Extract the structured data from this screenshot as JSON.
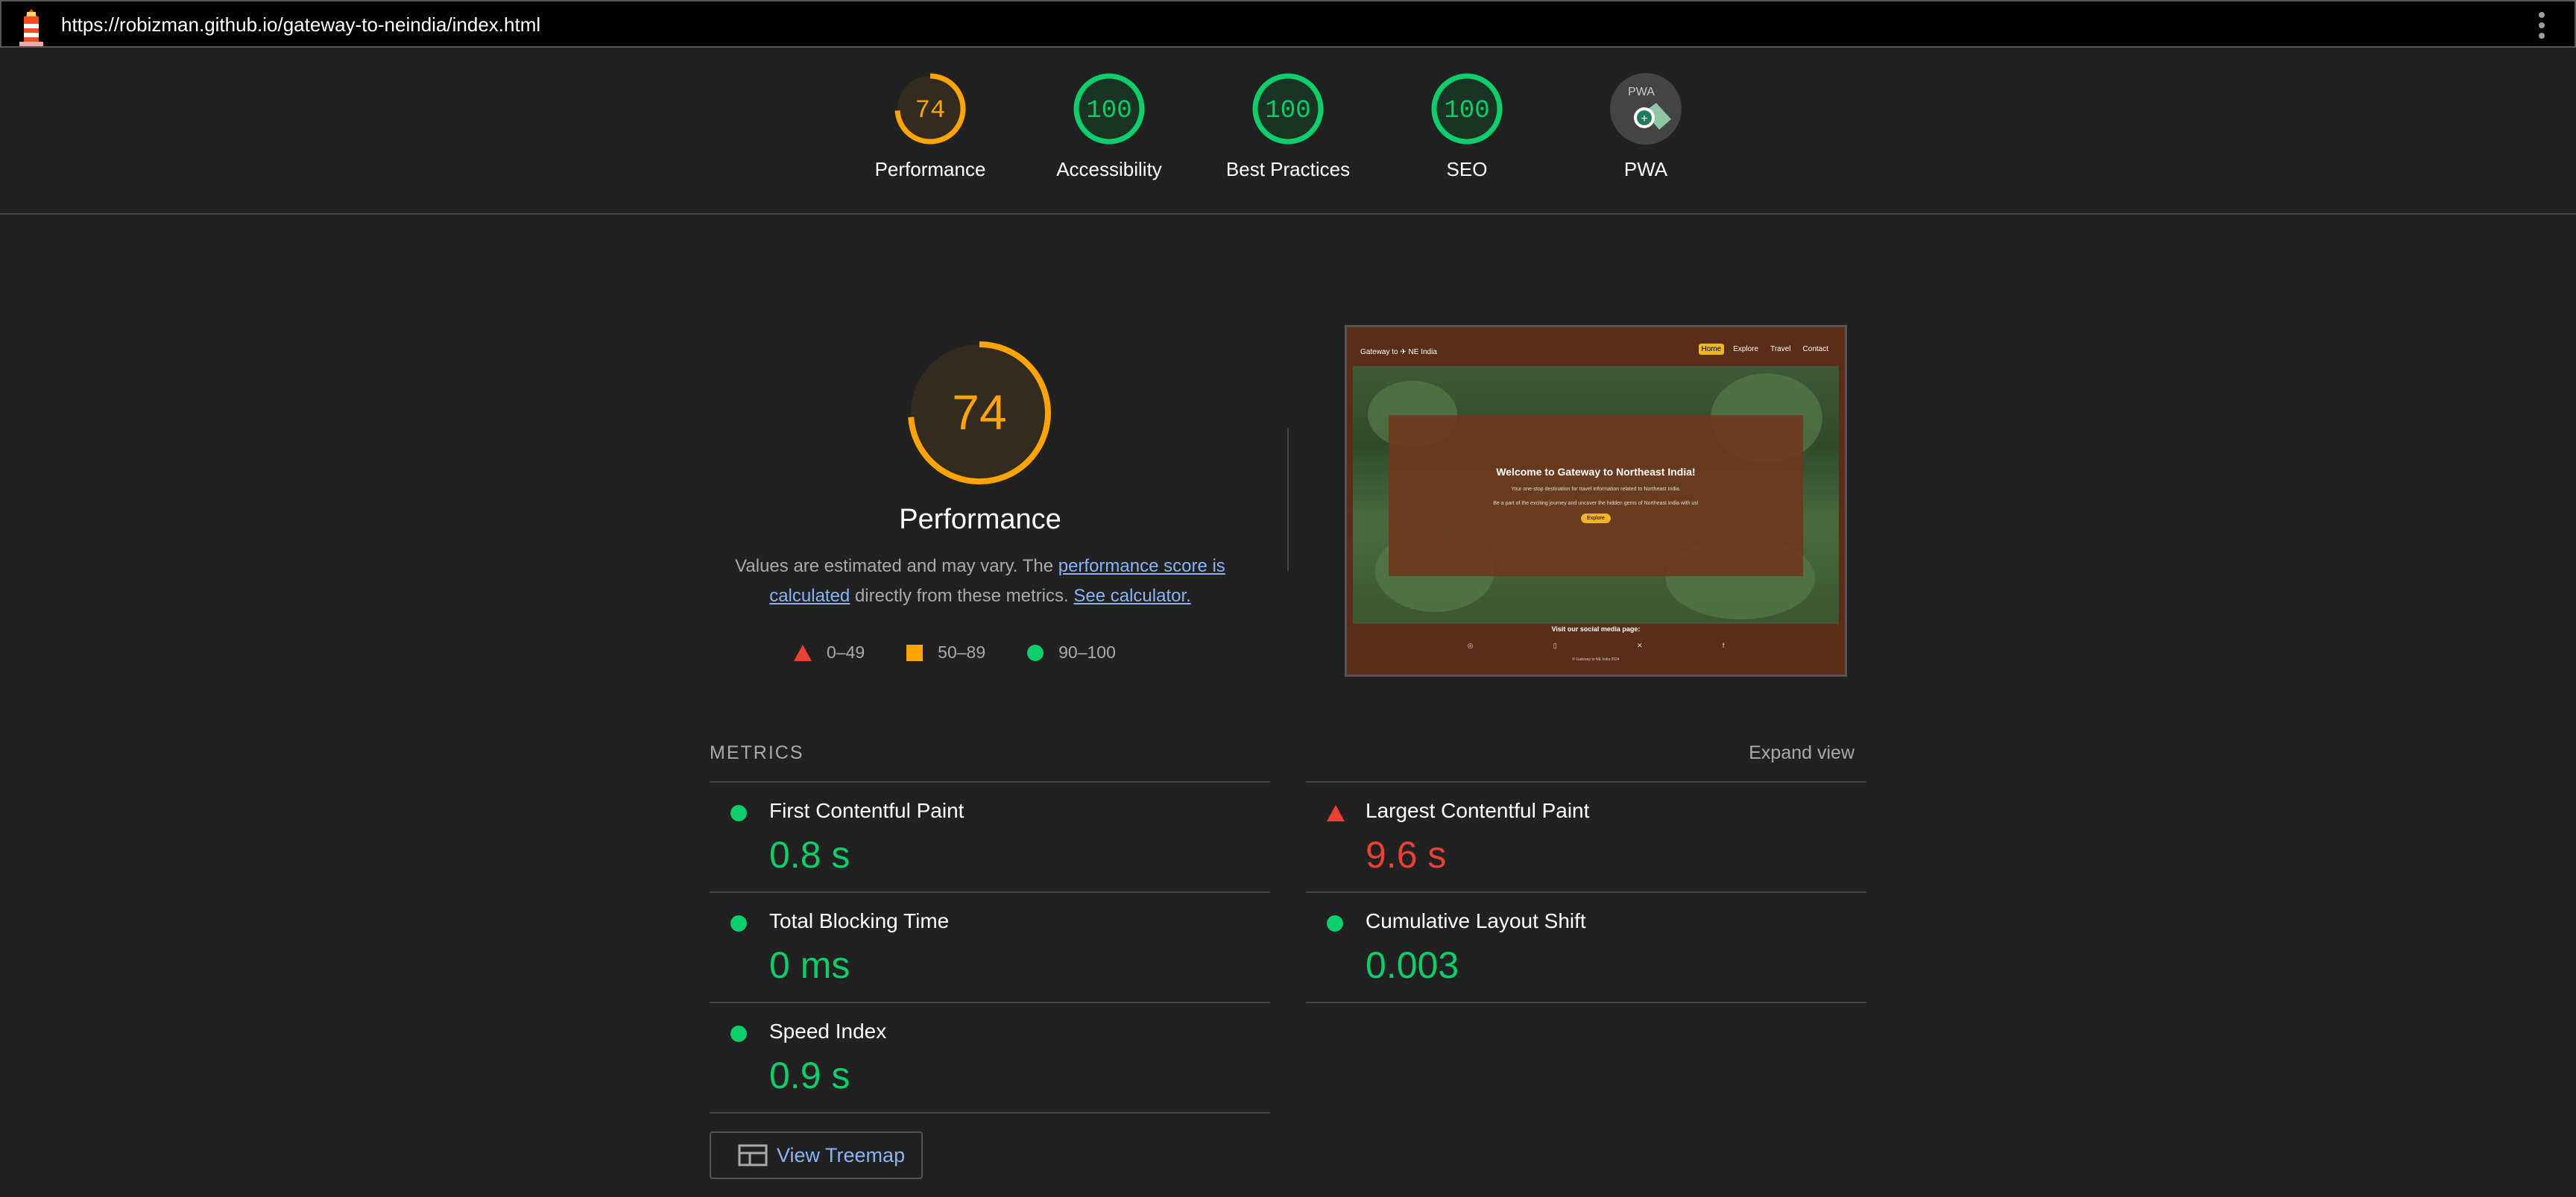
{
  "url": "https://robizman.github.io/gateway-to-neindia/index.html",
  "categories": [
    {
      "label": "Performance",
      "score": "74",
      "pct": 74,
      "color": "#ffa400"
    },
    {
      "label": "Accessibility",
      "score": "100",
      "pct": 100,
      "color": "#0cce6b"
    },
    {
      "label": "Best Practices",
      "score": "100",
      "pct": 100,
      "color": "#0cce6b"
    },
    {
      "label": "SEO",
      "score": "100",
      "pct": 100,
      "color": "#0cce6b"
    },
    {
      "label": "PWA",
      "score": "",
      "pct": 0,
      "color": "#9aa0a6",
      "badge": "PWA"
    }
  ],
  "performance": {
    "score": "74",
    "pct": 74,
    "title": "Performance",
    "desc_prefix": "Values are estimated and may vary. The ",
    "desc_link1": "performance score is calculated",
    "desc_middle": " directly from these metrics. ",
    "desc_link2": "See calculator.",
    "legend": [
      "0–49",
      "50–89",
      "90–100"
    ]
  },
  "screenshot": {
    "brand": "Gateway to",
    "brand_suffix": "NE India",
    "nav": [
      "Home",
      "Explore",
      "Travel",
      "Contact"
    ],
    "hero_title": "Welcome to Gateway to Northeast India!",
    "hero_text1": "Your one-stop destination for travel information related to Northeast India.",
    "hero_text2": "Be a part of the exciting journey and uncover the hidden gems of Northeast India with us!",
    "hero_button": "Explore",
    "footer_title": "Visit our social media page:",
    "footer_icons": [
      "◎",
      "▯",
      "✕",
      "f"
    ],
    "footer_copy": "© Gateway to NE India 2024"
  },
  "metrics": {
    "header": "METRICS",
    "expand": "Expand view",
    "items": [
      {
        "name": "First Contentful Paint",
        "value": "0.8 s",
        "status": "pass"
      },
      {
        "name": "Largest Contentful Paint",
        "value": "9.6 s",
        "status": "fail"
      },
      {
        "name": "Total Blocking Time",
        "value": "0 ms",
        "status": "pass"
      },
      {
        "name": "Cumulative Layout Shift",
        "value": "0.003",
        "status": "pass"
      },
      {
        "name": "Speed Index",
        "value": "0.9 s",
        "status": "pass"
      }
    ]
  },
  "treemap_label": "View Treemap",
  "colors": {
    "pass": "#0cce6b",
    "average": "#ffa400",
    "fail": "#eb4034",
    "link": "#8ab4f8"
  }
}
